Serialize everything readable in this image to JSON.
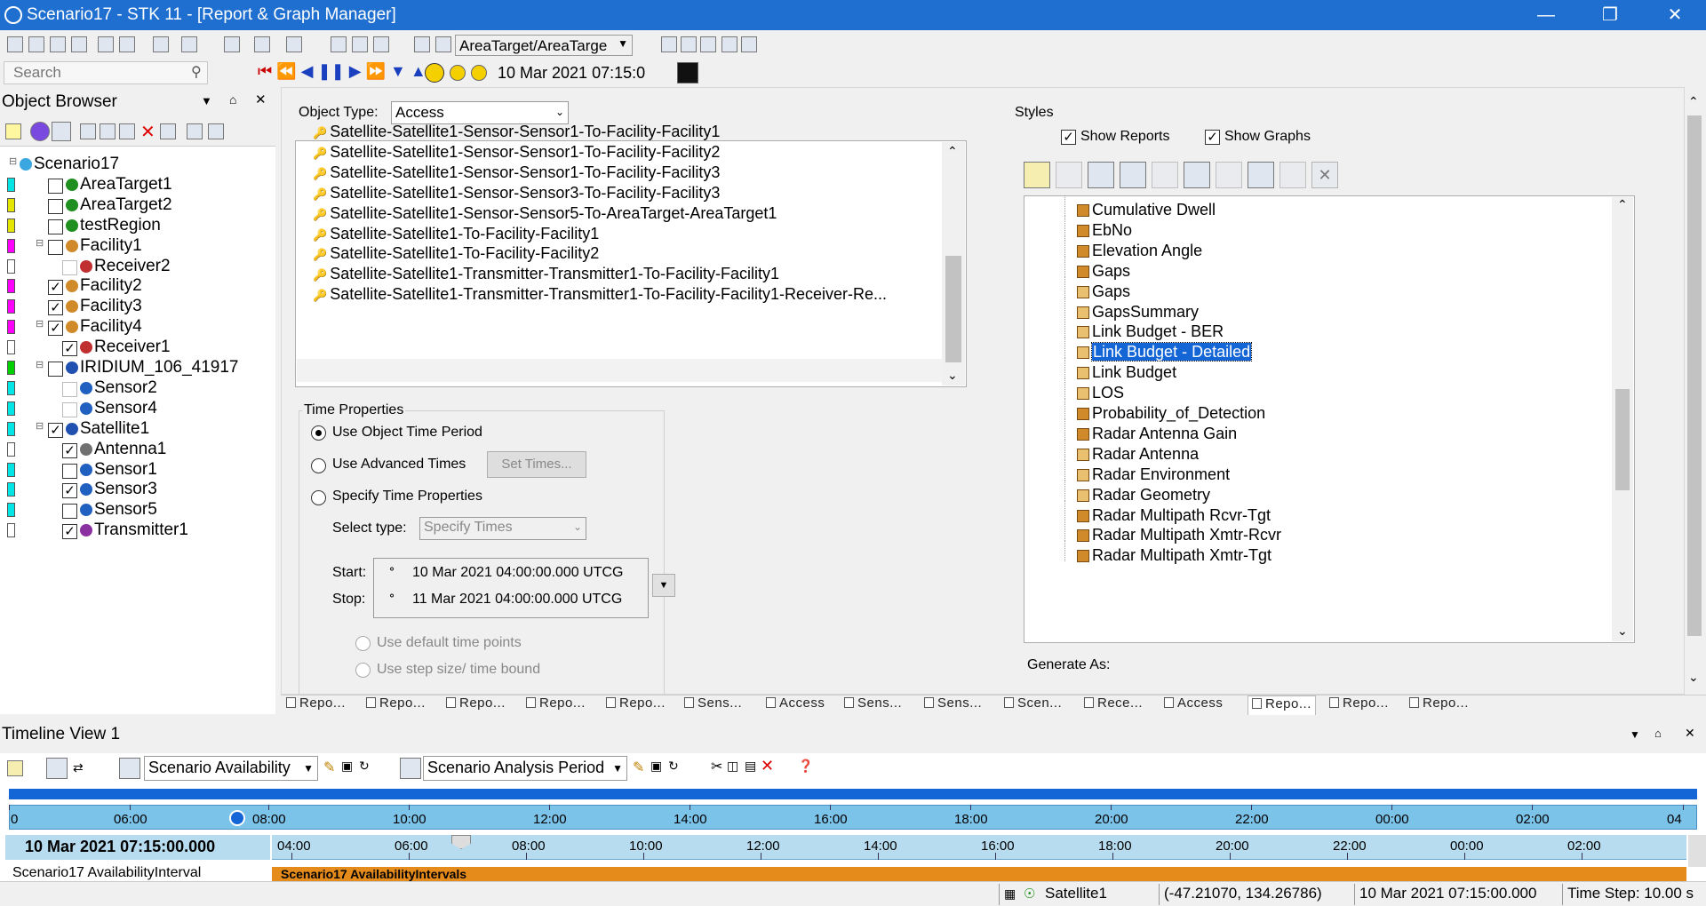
{
  "window": {
    "title": "Scenario17 - STK 11 - [Report & Graph Manager]"
  },
  "toolbar": {
    "object_combo": "AreaTarget/AreaTarge",
    "search_placeholder": "Search",
    "current_time": "10 Mar 2021 07:15:0"
  },
  "object_browser": {
    "title": "Object Browser",
    "items": [
      {
        "label": "Scenario17",
        "color": ""
      },
      {
        "label": "AreaTarget1",
        "color": "#00e5e5"
      },
      {
        "label": "AreaTarget2",
        "color": "#e5e500"
      },
      {
        "label": "testRegion",
        "color": "#e5e500"
      },
      {
        "label": "Facility1",
        "color": "#ff00ff"
      },
      {
        "label": "Receiver2",
        "color": "#ffffff"
      },
      {
        "label": "Facility2",
        "color": "#ff00ff"
      },
      {
        "label": "Facility3",
        "color": "#ff00ff"
      },
      {
        "label": "Facility4",
        "color": "#ff00ff"
      },
      {
        "label": "Receiver1",
        "color": "#ffffff"
      },
      {
        "label": "IRIDIUM_106_41917",
        "color": "#00d000"
      },
      {
        "label": "Sensor2",
        "color": "#00e5e5"
      },
      {
        "label": "Sensor4",
        "color": "#00e5e5"
      },
      {
        "label": "Satellite1",
        "color": "#00e5e5"
      },
      {
        "label": "Antenna1",
        "color": "#ffffff"
      },
      {
        "label": "Sensor1",
        "color": "#00e5e5"
      },
      {
        "label": "Sensor3",
        "color": "#00e5e5"
      },
      {
        "label": "Sensor5",
        "color": "#00e5e5"
      },
      {
        "label": "Transmitter1",
        "color": "#ffffff"
      }
    ]
  },
  "report_manager": {
    "object_type_label": "Object Type:",
    "object_type_value": "Access",
    "objects": [
      "Satellite-Satellite1-Sensor-Sensor1-To-Facility-Facility1",
      "Satellite-Satellite1-Sensor-Sensor1-To-Facility-Facility2",
      "Satellite-Satellite1-Sensor-Sensor1-To-Facility-Facility3",
      "Satellite-Satellite1-Sensor-Sensor3-To-Facility-Facility3",
      "Satellite-Satellite1-Sensor-Sensor5-To-AreaTarget-AreaTarget1",
      "Satellite-Satellite1-To-Facility-Facility1",
      "Satellite-Satellite1-To-Facility-Facility2",
      "Satellite-Satellite1-Transmitter-Transmitter1-To-Facility-Facility1",
      "Satellite-Satellite1-Transmitter-Transmitter1-To-Facility-Facility1-Receiver-Re..."
    ],
    "time_properties": {
      "title": "Time Properties",
      "use_object_time": "Use Object Time Period",
      "use_advanced": "Use Advanced Times",
      "set_times": "Set Times...",
      "specify": "Specify Time Properties",
      "select_type_label": "Select type:",
      "select_type_value": "Specify Times",
      "start_label": "Start:",
      "start_value": "10 Mar 2021 04:00:00.000 UTCG",
      "stop_label": "Stop:",
      "stop_value": "11 Mar 2021 04:00:00.000 UTCG",
      "default_points": "Use default time points",
      "step_size": "Use step size/ time bound"
    },
    "styles": {
      "title": "Styles",
      "show_reports": "Show Reports",
      "show_graphs": "Show Graphs",
      "items": [
        "Cumulative Dwell",
        "EbNo",
        "Elevation Angle",
        "Gaps",
        "Gaps",
        "GapsSummary",
        "Link Budget - BER",
        "Link Budget - Detailed",
        "Link Budget",
        "LOS",
        "Probability_of_Detection",
        "Radar Antenna Gain",
        "Radar Antenna",
        "Radar Environment",
        "Radar Geometry",
        "Radar Multipath Rcvr-Tgt",
        "Radar Multipath Xmtr-Rcvr",
        "Radar Multipath Xmtr-Tgt"
      ],
      "selected": "Link Budget - Detailed",
      "generate_as": "Generate As:"
    }
  },
  "doc_tabs": [
    "Repo...",
    "Repo...",
    "Repo...",
    "Repo...",
    "Repo...",
    "Sens...",
    "Access",
    "Sens...",
    "Sens...",
    "Scen...",
    "Rece...",
    "Access",
    "Repo...",
    "Repo...",
    "Repo..."
  ],
  "timeline": {
    "title": "Timeline View 1",
    "availability_combo": "Scenario Availability",
    "analysis_combo": "Scenario Analysis Period",
    "overview_ticks": [
      "0",
      "06:00",
      "08:00",
      "10:00",
      "12:00",
      "14:00",
      "16:00",
      "18:00",
      "20:00",
      "22:00",
      "00:00",
      "02:00",
      "04"
    ],
    "current_time": "10 Mar 2021 07:15:00.000",
    "detail_ticks": [
      "04:00",
      "06:00",
      "08:00",
      "10:00",
      "12:00",
      "14:00",
      "16:00",
      "18:00",
      "20:00",
      "22:00",
      "00:00",
      "02:00"
    ],
    "row_label": "Scenario17 AvailabilityInterval",
    "bar_label": "Scenario17 AvailabilityIntervals"
  },
  "statusbar": {
    "object": "Satellite1",
    "coords": "(-47.21070, 134.26786)",
    "time": "10 Mar 2021 07:15:00.000",
    "step": "Time Step: 10.00 s"
  }
}
